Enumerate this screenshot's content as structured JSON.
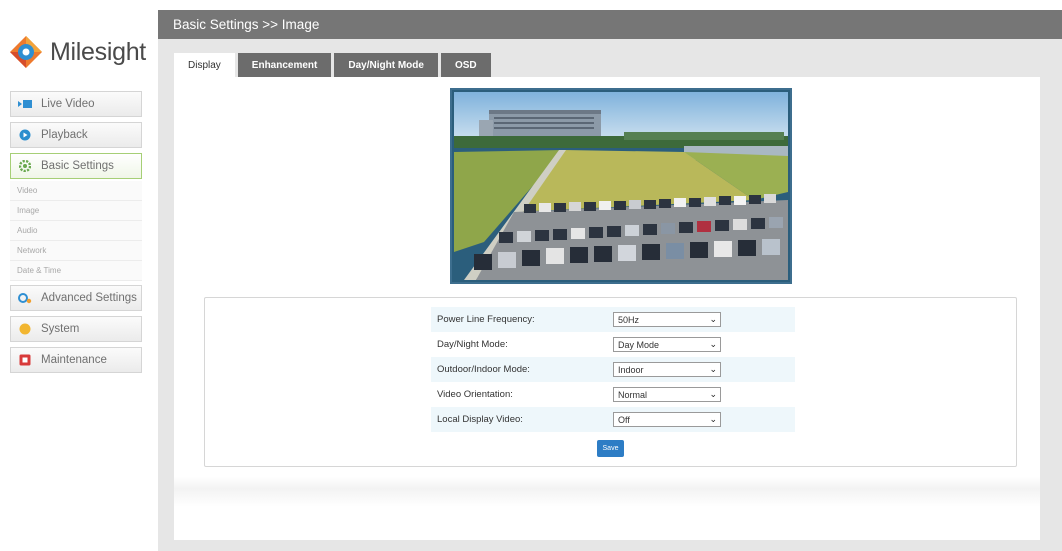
{
  "brand": {
    "name": "Milesight"
  },
  "sidebar": {
    "items": [
      {
        "label": "Live Video",
        "icon": "live-video-icon"
      },
      {
        "label": "Playback",
        "icon": "playback-icon"
      },
      {
        "label": "Basic Settings",
        "icon": "basic-settings-icon",
        "subitems": [
          "Video",
          "Image",
          "Audio",
          "Network",
          "Date & Time"
        ]
      },
      {
        "label": "Advanced Settings",
        "icon": "advanced-settings-icon"
      },
      {
        "label": "System",
        "icon": "system-icon"
      },
      {
        "label": "Maintenance",
        "icon": "maintenance-icon"
      }
    ]
  },
  "header": {
    "breadcrumb": "Basic Settings >> Image"
  },
  "tabs": [
    "Display",
    "Enhancement",
    "Day/Night Mode",
    "OSD"
  ],
  "form": {
    "fields": [
      {
        "label": "Power Line Frequency:",
        "value": "50Hz"
      },
      {
        "label": "Day/Night Mode:",
        "value": "Day Mode"
      },
      {
        "label": "Outdoor/Indoor Mode:",
        "value": "Indoor"
      },
      {
        "label": "Video Orientation:",
        "value": "Normal"
      },
      {
        "label": "Local Display Video:",
        "value": "Off"
      }
    ],
    "save_label": "Save"
  },
  "colors": {
    "topbar": "#767676",
    "tab": "#6c6c6c",
    "save": "#2d7dc5",
    "active_border": "#a6cf76"
  }
}
